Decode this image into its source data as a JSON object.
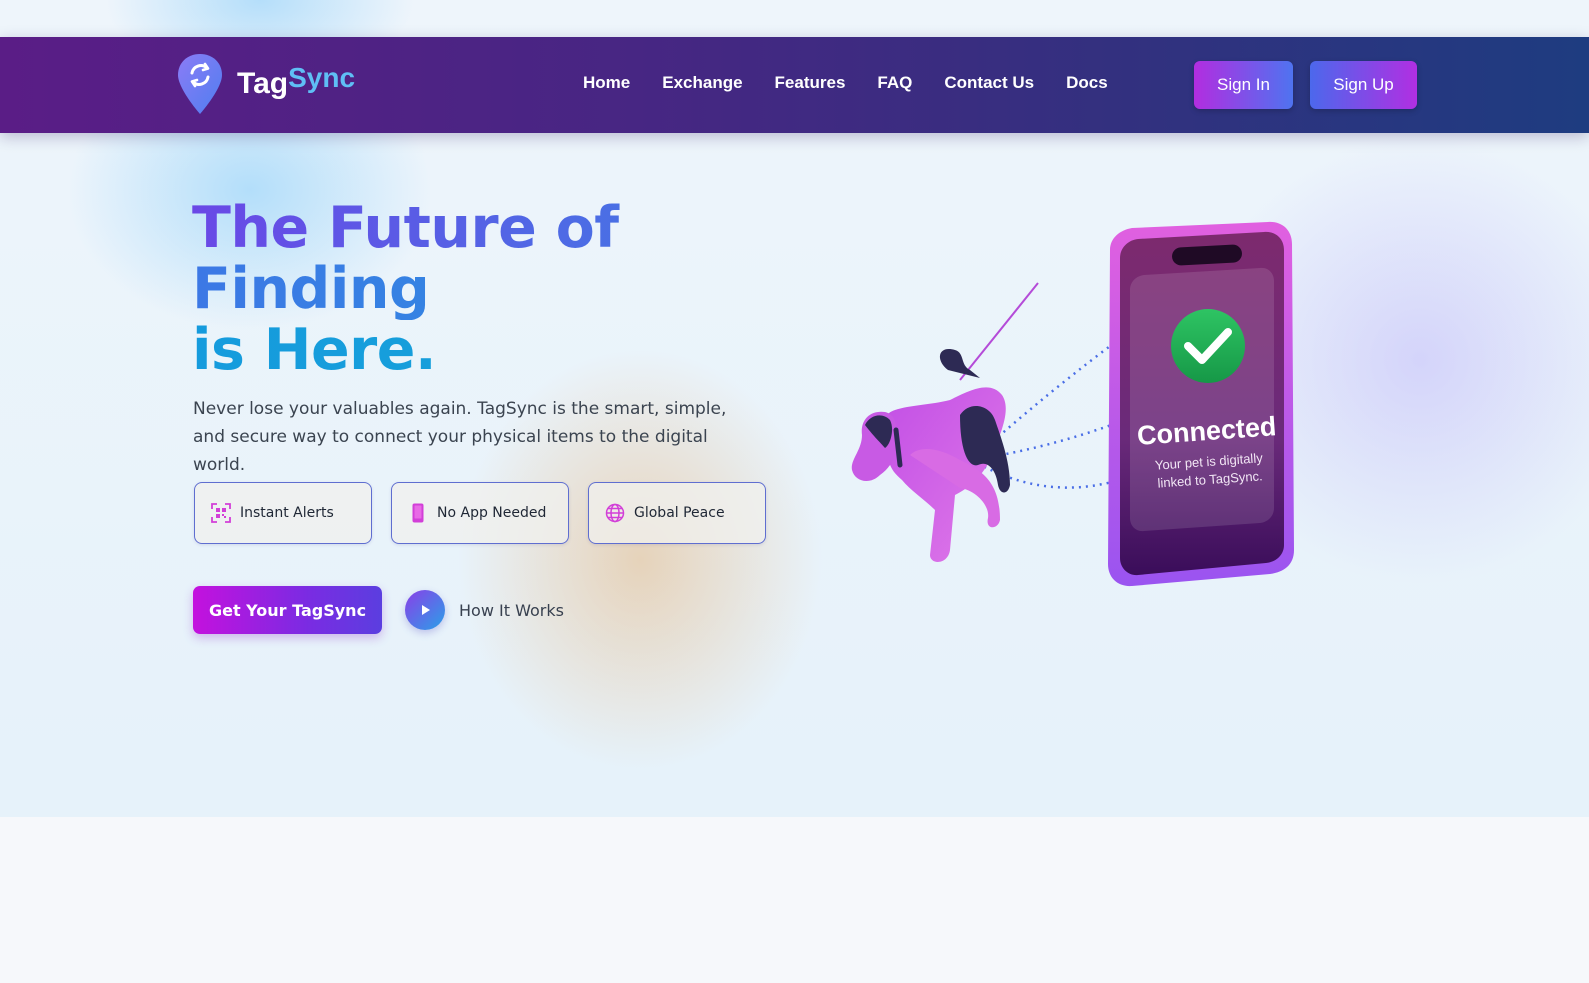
{
  "brand": {
    "name_part1": "Tag",
    "name_part2": "Sync"
  },
  "nav": {
    "links": [
      "Home",
      "Exchange",
      "Features",
      "FAQ",
      "Contact Us",
      "Docs"
    ],
    "sign_in": "Sign In",
    "sign_up": "Sign Up"
  },
  "hero": {
    "title_line1": "The Future of",
    "title_line2": "Finding",
    "title_line3": "is Here.",
    "subtitle": "Never lose your valuables again. TagSync is the smart, simple, and secure way to connect your physical items to the digital world.",
    "features": [
      {
        "label": "Instant Alerts",
        "icon": "qr-code-icon"
      },
      {
        "label": "No App Needed",
        "icon": "smartphone-icon"
      },
      {
        "label": "Global Peace",
        "icon": "globe-icon"
      }
    ],
    "cta": "Get Your TagSync",
    "how_it_works": "How It Works"
  },
  "phone": {
    "status_title": "Connected",
    "status_line1": "Your pet is digitally",
    "status_line2": "linked to TagSync."
  },
  "colors": {
    "nav_start": "#5a1d86",
    "nav_end": "#1e3c80",
    "accent_magenta": "#c411de",
    "accent_blue": "#4c68ec",
    "check_green": "#22b455"
  }
}
